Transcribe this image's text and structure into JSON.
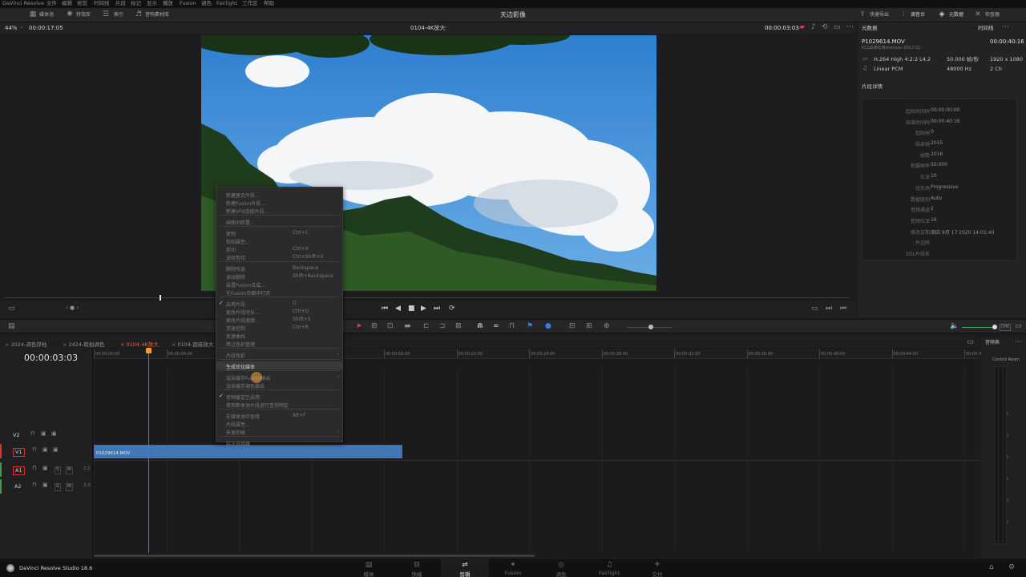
{
  "menubar": {
    "items": [
      "DaVinci Resolve",
      "文件",
      "编辑",
      "修剪",
      "时间线",
      "片段",
      "标记",
      "显示",
      "播放",
      "Fusion",
      "调色",
      "Fairlight",
      "工作区",
      "帮助"
    ]
  },
  "toolbar": {
    "media_pool": "媒体池",
    "effects": "特效库",
    "index": "索引",
    "sound_library": "音响素材库",
    "project_title": "天边影像",
    "quick_export": "快捷导出",
    "mixer": "调音台",
    "metadata": "元数据",
    "inspector": "检查器"
  },
  "viewer": {
    "zoom": "44%",
    "source_tc": "00:00:17:05",
    "timeline_name": "0104-4K放大",
    "current_tc": "00:00:03:03",
    "timeline_label": "时间线"
  },
  "metadata": {
    "title": "元数据",
    "filename": "P1029614.MOV",
    "duration": "00:00:40:16",
    "path": "K11出峰松茸shanyan-0917-S1",
    "codec": "H.264 High 4:2:2 L4.2",
    "fps": "50.000 帧/秒",
    "res": "1920 x 1080",
    "audio_codec": "Linear PCM",
    "sample_rate": "48000 Hz",
    "channels": "2 Ch",
    "details_title": "片段详情",
    "details": [
      {
        "k": "起始时间码",
        "v": "00:00:00:00"
      },
      {
        "k": "结束时间码",
        "v": "00:00:40:16"
      },
      {
        "k": "起始帧",
        "v": "0"
      },
      {
        "k": "结束帧",
        "v": "2015"
      },
      {
        "k": "帧数",
        "v": "2016"
      },
      {
        "k": "拍摄帧率",
        "v": "50.000"
      },
      {
        "k": "位深",
        "v": "10"
      },
      {
        "k": "优先场",
        "v": "Progressive"
      },
      {
        "k": "数据级别",
        "v": "Auto"
      },
      {
        "k": "音频通道",
        "v": "2"
      },
      {
        "k": "音频位深",
        "v": "16"
      },
      {
        "k": "修改日期",
        "v": "周四 9月 17 2020 14:01:40"
      },
      {
        "k": "片边码",
        "v": ""
      },
      {
        "k": "EDL片段名",
        "v": ""
      }
    ]
  },
  "timeline": {
    "tabs": [
      "2024-调色存档",
      "2424-取拍调色",
      "0104-4K放大",
      "0104-超级放大"
    ],
    "timecode": "00:00:03:03",
    "ruler": [
      "00:00:00:00",
      "00:00:04:00",
      "00:00:08:00",
      "00:00:12:00",
      "00:00:16:00",
      "00:00:20:00",
      "00:00:24:00",
      "00:00:28:00",
      "00:00:32:00",
      "00:00:36:00",
      "00:00:40:00",
      "00:00:44:00",
      "00:00:48:00"
    ],
    "tracks": [
      {
        "id": "V2",
        "level": ""
      },
      {
        "id": "V1",
        "level": ""
      },
      {
        "id": "A1",
        "level": "2.0"
      },
      {
        "id": "A2",
        "level": "2.0"
      }
    ],
    "clip_name": "P1029614.MOV"
  },
  "audio_panel": {
    "title": "音频表",
    "room": "Control Room",
    "scale": [
      "0",
      "-5",
      "-10",
      "-15",
      "-20",
      "-30",
      "-40",
      "-50"
    ]
  },
  "context_menu": [
    {
      "l": "新建复合片段...",
      "s": "",
      "en": false
    },
    {
      "l": "新建Fusion片段...",
      "s": "",
      "en": false
    },
    {
      "l": "新建VFX连接片段...",
      "s": "",
      "en": false
    },
    {
      "sep": true
    },
    {
      "l": "画面间距置...",
      "s": "",
      "en": false
    },
    {
      "sep": true
    },
    {
      "l": "复制",
      "s": "Ctrl+C",
      "en": false
    },
    {
      "l": "粘贴属性...",
      "s": "",
      "en": false
    },
    {
      "l": "剪切",
      "s": "Ctrl+X",
      "en": false
    },
    {
      "l": "波纹剪切",
      "s": "Ctrl+Shift+X",
      "en": false
    },
    {
      "sep": true
    },
    {
      "l": "删除所选",
      "s": "Backspace",
      "en": false
    },
    {
      "l": "波纹删除",
      "s": "Shift+Backspace",
      "en": false
    },
    {
      "l": "装置Fusion合成...",
      "s": "",
      "en": false
    },
    {
      "l": "在Fusion页面中打开",
      "s": "",
      "en": false
    },
    {
      "sep": true
    },
    {
      "l": "启用片段",
      "s": "D",
      "en": false,
      "check": true
    },
    {
      "l": "更改片段时长...",
      "s": "Ctrl+D",
      "en": false
    },
    {
      "l": "更改片段速度...",
      "s": "Shift+S",
      "en": false
    },
    {
      "l": "变速控制",
      "s": "Ctrl+R",
      "en": false
    },
    {
      "l": "变速曲线",
      "s": "",
      "en": false
    },
    {
      "l": "降过色彩管理",
      "s": "",
      "en": false
    },
    {
      "sep": true
    },
    {
      "l": "片段色彩",
      "s": "",
      "en": false,
      "arrow": true
    },
    {
      "sep": true
    },
    {
      "l": "生成优化媒体",
      "s": "",
      "en": true,
      "hl": true
    },
    {
      "sep": true
    },
    {
      "l": "渲染缓存Fusion输出",
      "s": "",
      "en": false,
      "arrow": true
    },
    {
      "l": "渲染缓存调色输出",
      "s": "",
      "en": false
    },
    {
      "sep": true
    },
    {
      "l": "音频缓定已启用",
      "s": "",
      "en": false,
      "check": true
    },
    {
      "l": "使用新体池片段进行音视频定",
      "s": "",
      "en": false
    },
    {
      "sep": true
    },
    {
      "l": "在媒体池中查找",
      "s": "Alt+F",
      "en": false
    },
    {
      "l": "片段属性...",
      "s": "",
      "en": false
    },
    {
      "l": "夹发的帧",
      "s": "",
      "en": false,
      "arrow": true
    },
    {
      "sep": true
    },
    {
      "l": "启次选择器",
      "s": "",
      "en": false
    }
  ],
  "pages": [
    {
      "label": "媒体",
      "icon": "▤"
    },
    {
      "label": "快编",
      "icon": "⊟"
    },
    {
      "label": "剪辑",
      "icon": "⇌",
      "active": true
    },
    {
      "label": "Fusion",
      "icon": "✦"
    },
    {
      "label": "调色",
      "icon": "◎"
    },
    {
      "label": "Fairlight",
      "icon": "♫"
    },
    {
      "label": "交付",
      "icon": "✈"
    }
  ],
  "footer": {
    "app": "DaVinci Resolve Studio 18.6"
  }
}
